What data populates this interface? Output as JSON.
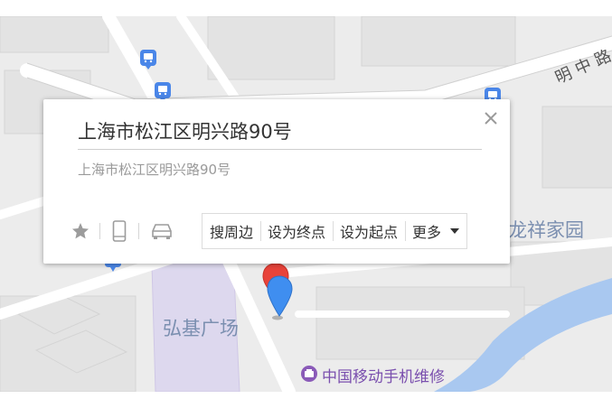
{
  "popup": {
    "title": "上海市松江区明兴路90号",
    "address": "上海市松江区明兴路90号",
    "actions": {
      "search_nearby": "搜周边",
      "set_destination": "设为终点",
      "set_origin": "设为起点",
      "more": "更多"
    },
    "icons": [
      "star-icon",
      "phone-icon",
      "car-icon",
      "close-icon",
      "caret-down-icon"
    ]
  },
  "map": {
    "road_label": "明 中 路",
    "place_labels": {
      "longxiang": "龙祥家园",
      "hongji": "弘基广场"
    },
    "poi": {
      "label": "中国移动手机维修",
      "icon": "shop-poi-icon"
    },
    "marker_icons": [
      "bus-stop-icon",
      "location-pin-icon"
    ],
    "colors": {
      "background": "#ececec",
      "road": "#ffffff",
      "block": "#e2e2e2",
      "plaza": "#ded9ee",
      "water": "#a8c9f2",
      "pin_red": "#e8433a",
      "pin_blue": "#3f8ef0",
      "bus": "#4a86e8",
      "poi": "#8a5ab8"
    }
  }
}
